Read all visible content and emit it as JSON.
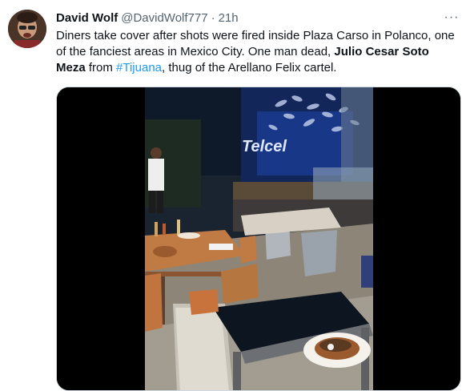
{
  "tweet": {
    "author_name": "David Wolf",
    "author_handle": "@DavidWolf777",
    "separator": "·",
    "time": "21h",
    "more_label": "···",
    "text_parts": {
      "t1": "Diners take cover after shots were fired inside Plaza Carso in Polanco, one of the fanciest areas in Mexico City. One man dead, ",
      "bold_name": "Julio Cesar Soto Meza",
      "t2": " from ",
      "hashtag": "#Tijuana",
      "t3": ", thug of the Arellano Felix cartel."
    }
  },
  "video": {
    "sign_text": "Telcel",
    "icon": "video-frame"
  },
  "colors": {
    "hashtag": "#1d9bf0",
    "secondary": "#536471"
  }
}
